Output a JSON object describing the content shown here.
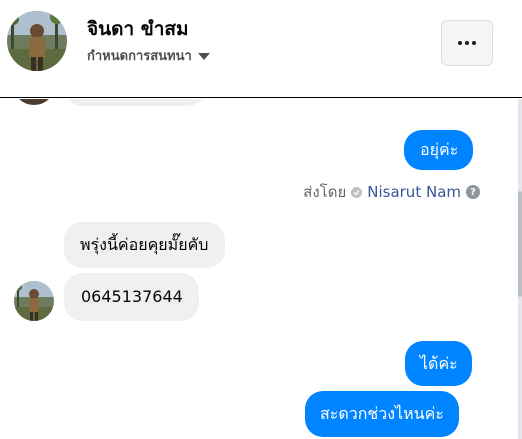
{
  "header": {
    "contact_name": "จินดา ขำสม",
    "conversation_setting": "กำหนดการสนทนา"
  },
  "messages": [
    {
      "direction": "out",
      "text": "อยุ่ค่ะ"
    },
    {
      "direction": "in",
      "text": "พรุ่งนี้ค่อยคุยมั๊ยคับ"
    },
    {
      "direction": "in",
      "text": "0645137644"
    },
    {
      "direction": "out",
      "text": "ได้ค่ะ"
    },
    {
      "direction": "out",
      "text": "สะดวกช่วงไหนค่ะ"
    }
  ],
  "sent_by": {
    "prefix": "ส่งโดย",
    "name": "Nisarut Nam",
    "help_glyph": "?"
  },
  "colors": {
    "outgoing_bubble": "#0084ff",
    "incoming_bubble": "#f0f0f0",
    "sender_link": "#385898"
  },
  "icons": {
    "more": "more-options-icon",
    "dropdown": "caret-down-icon",
    "sent_status": "check-circle-icon",
    "help": "help-icon"
  }
}
